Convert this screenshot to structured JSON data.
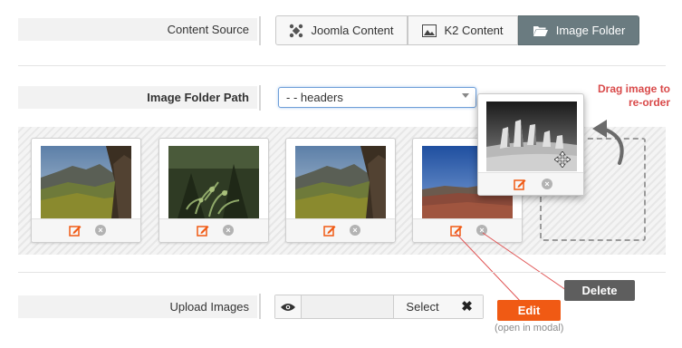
{
  "content_source": {
    "label": "Content Source",
    "options": [
      {
        "label": "Joomla Content",
        "icon": "joomla-icon",
        "active": false
      },
      {
        "label": "K2 Content",
        "icon": "image-icon",
        "active": false
      },
      {
        "label": "Image Folder",
        "icon": "folder-open-icon",
        "active": true
      }
    ]
  },
  "image_folder": {
    "label": "Image Folder Path",
    "selected": "- - headers"
  },
  "gallery": {
    "images": [
      {
        "name": "mountain-valley-1",
        "edit_icon": "edit-icon",
        "delete_icon": "delete-icon"
      },
      {
        "name": "forest-ferns",
        "edit_icon": "edit-icon",
        "delete_icon": "delete-icon"
      },
      {
        "name": "mountain-valley-2",
        "edit_icon": "edit-icon",
        "delete_icon": "delete-icon"
      },
      {
        "name": "red-plains",
        "edit_icon": "edit-icon",
        "delete_icon": "delete-icon"
      }
    ],
    "dragging": {
      "name": "desert-rocks-bw",
      "cursor": "move-icon"
    }
  },
  "annotations": {
    "drag_hint": "Drag image to re-order",
    "delete": "Delete",
    "edit": "Edit",
    "edit_note": "(open in modal)"
  },
  "upload": {
    "label": "Upload Images",
    "select_label": "Select",
    "clear_symbol": "✖"
  },
  "colors": {
    "active_tab": "#6a7b80",
    "edit_orange": "#f05a14",
    "delete_gray": "#5e5e5e",
    "hint_red": "#d94a4a"
  }
}
